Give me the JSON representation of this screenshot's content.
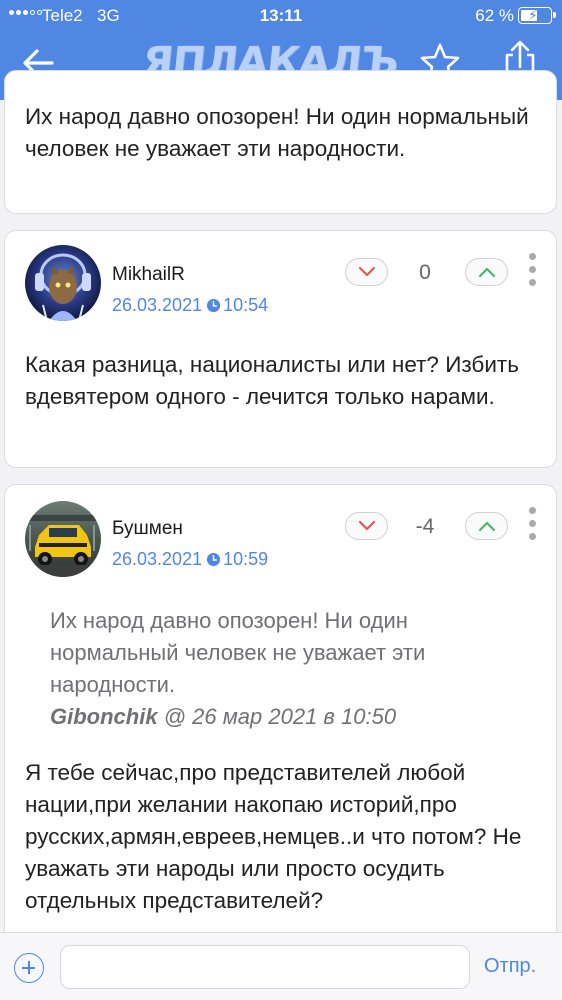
{
  "status_bar": {
    "carrier": "Tele2",
    "network": "3G",
    "time": "13:11",
    "battery_percent": "62 %",
    "battery_level": 0.62
  },
  "header": {
    "logo_text": "ЯПЛАКАЛЪ",
    "back_icon": "arrow-left-icon",
    "favorite_icon": "star-icon",
    "share_icon": "share-icon"
  },
  "posts": [
    {
      "body": "Их народ давно опозорен! Ни один нормальный человек не уважает эти народности."
    },
    {
      "author": "MikhailR",
      "date": "26.03.2021",
      "time": "10:54",
      "votes": "0",
      "body": "Какая разница, националисты или нет? Избить вдевятером одного - лечится только нарами."
    },
    {
      "author": "Бушмен",
      "date": "26.03.2021",
      "time": "10:59",
      "votes": "-4",
      "quote": {
        "text": "Их народ давно опозорен! Ни один нормальный человек не уважает эти народности.",
        "author": "Gibonchik",
        "meta": " @ 26 мар 2021 в 10:50"
      },
      "body": "Я тебе сейчас,про представителей любой нации,при желании накопаю историй,про русских,армян,евреев,немцев..и что потом? Не уважать эти народы или просто осудить отдельных представителей?"
    }
  ],
  "composer": {
    "value": "",
    "send_label": "Отпр."
  },
  "colors": {
    "accent": "#4f87e3",
    "card_background": "#ffffff",
    "page_background": "#f2f2f4"
  }
}
